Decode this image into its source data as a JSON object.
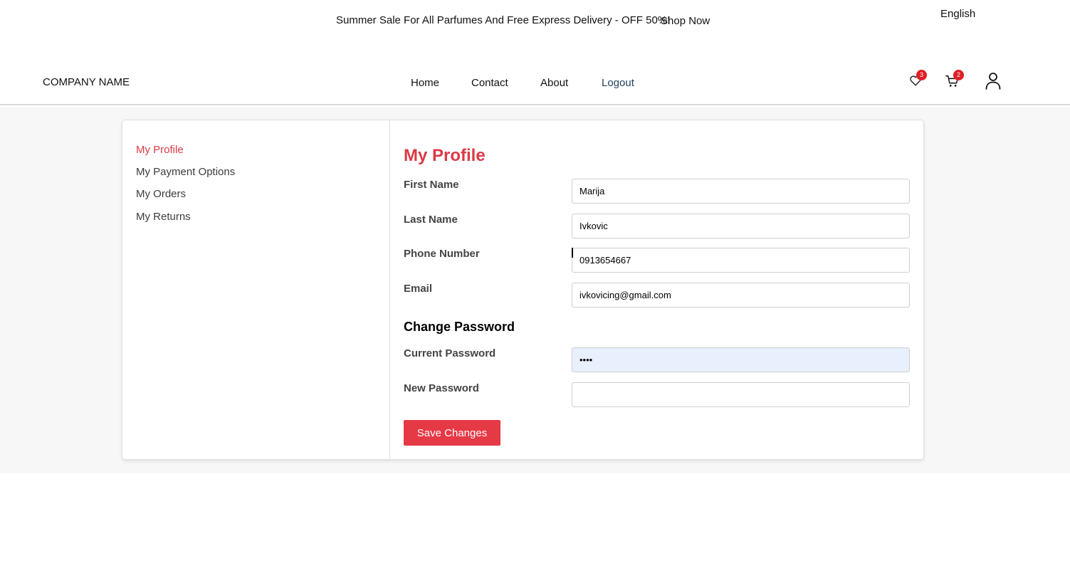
{
  "topbar": {
    "promo_text": "Summer Sale For All Parfumes And Free Express Delivery - OFF 50%!",
    "shop_now": "Shop Now",
    "language": "English"
  },
  "navbar": {
    "company_name": "COMPANY NAME",
    "links": [
      {
        "label": "Home"
      },
      {
        "label": "Contact"
      },
      {
        "label": "About"
      },
      {
        "label": "Logout"
      }
    ],
    "wishlist_count": "3",
    "cart_count": "2",
    "icons": [
      "heart-icon",
      "cart-icon",
      "user-icon"
    ]
  },
  "sidebar": {
    "items": [
      {
        "label": "My Profile",
        "active": true
      },
      {
        "label": "My Payment Options"
      },
      {
        "label": "My Orders"
      },
      {
        "label": "My Returns"
      }
    ]
  },
  "profile": {
    "title": "My Profile",
    "fields": [
      {
        "label": "First Name",
        "value": "Marija"
      },
      {
        "label": "Last Name",
        "value": "Ivkovic"
      },
      {
        "label": "Phone Number",
        "value": "0913654667"
      },
      {
        "label": "Email",
        "value": "ivkovicing@gmail.com"
      }
    ],
    "change_password_heading": "Change Password",
    "password_fields": [
      {
        "label": "Current Password",
        "value": "1234"
      },
      {
        "label": "New Password",
        "value": ""
      }
    ],
    "save_label": "Save Changes"
  },
  "colors": {
    "accent": "#db3a45",
    "button": "#e63946",
    "badge": "#e01e26",
    "autofill": "#e8f0fe",
    "page_bg": "#f7f7f7"
  }
}
